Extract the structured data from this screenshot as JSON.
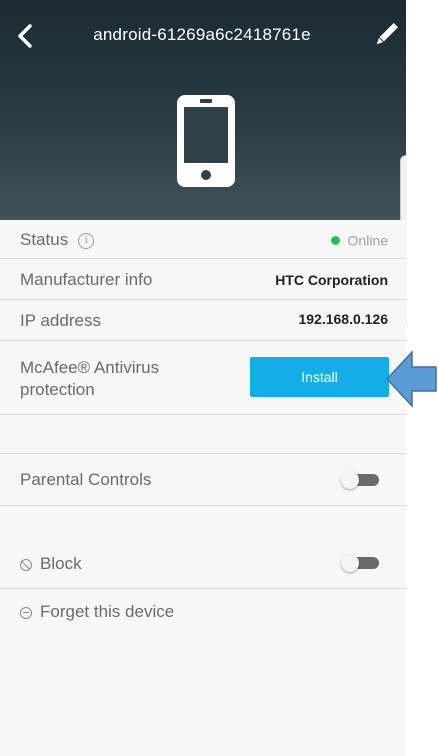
{
  "header": {
    "title": "android-61269a6c2418761e"
  },
  "icons": {
    "back": "chevron-left-icon",
    "edit": "pencil-icon",
    "device": "smartphone-icon",
    "info": "info-icon",
    "block": "block-icon",
    "forget": "forget-icon"
  },
  "rows": {
    "status": {
      "label": "Status",
      "value": "Online"
    },
    "manufacturer": {
      "label": "Manufacturer info",
      "value": "HTC Corporation"
    },
    "ip": {
      "label": "IP address",
      "value": "192.168.0.126"
    },
    "antivirus": {
      "label_line1": "McAfee® Antivirus",
      "label_line2": "protection",
      "button": "Install"
    }
  },
  "parental": {
    "label": "Parental Controls",
    "enabled": false
  },
  "block": {
    "label": "Block",
    "enabled": false
  },
  "forget": {
    "label": "Forget this device"
  },
  "colors": {
    "accent": "#13aee8",
    "online": "#24c24a",
    "header_top": "#1b2a33",
    "arrow": "#5b9bd5"
  }
}
